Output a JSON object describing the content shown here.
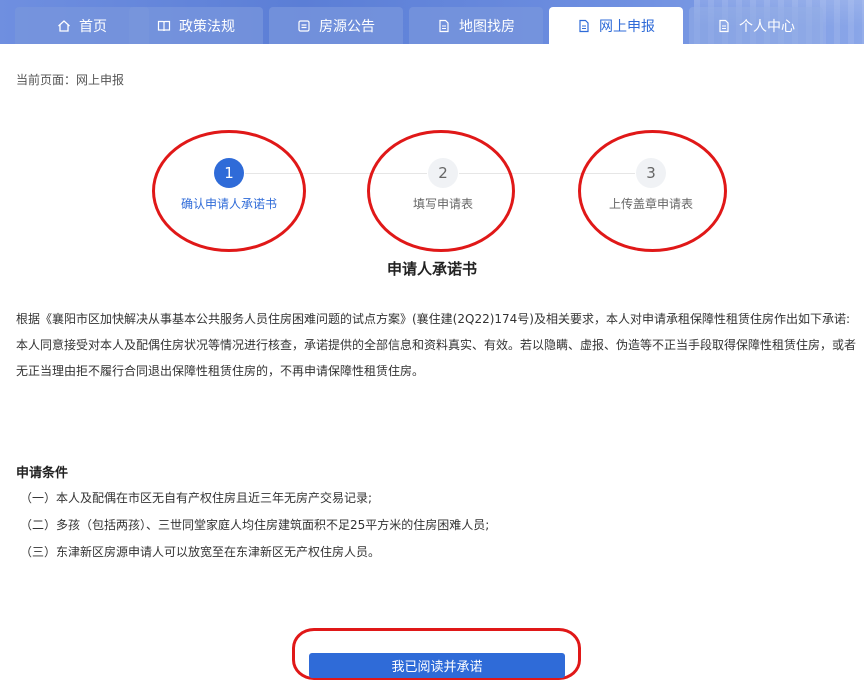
{
  "nav": {
    "tabs": [
      {
        "label": "首页",
        "icon": "home-icon",
        "active": false
      },
      {
        "label": "政策法规",
        "icon": "book-icon",
        "active": false
      },
      {
        "label": "房源公告",
        "icon": "notice-icon",
        "active": false
      },
      {
        "label": "地图找房",
        "icon": "document-icon",
        "active": false
      },
      {
        "label": "网上申报",
        "icon": "document-icon",
        "active": true
      },
      {
        "label": "个人中心",
        "icon": "document-icon",
        "active": false
      }
    ]
  },
  "breadcrumb": {
    "text": "当前页面：网上申报"
  },
  "steps": [
    {
      "number": "1",
      "label": "确认申请人承诺书",
      "status": "done"
    },
    {
      "number": "2",
      "label": "填写申请表",
      "status": "todo"
    },
    {
      "number": "3",
      "label": "上传盖章申请表",
      "status": "todo"
    }
  ],
  "commitment": {
    "title": "申请人承诺书",
    "paragraphs": [
      "根据《襄阳市区加快解决从事基本公共服务人员住房困难问题的试点方案》(襄住建(2Q22)174号)及相关要求，本人对申请承租保障性租赁住房作出如下承诺:",
      "本人同意接受对本人及配偶住房状况等情况进行核查，承诺提供的全部信息和资料真实、有效。若以隐瞒、虚报、伪造等不正当手段取得保障性租赁住房，或者无正当理由拒不履行合同退出保障性租赁住房的，不再申请保障性租赁住房。"
    ]
  },
  "conditions": {
    "title": "申请条件",
    "items": [
      "（一）本人及配偶在市区无自有产权住房且近三年无房产交易记录;",
      "（二）多孩（包括两孩）、三世同堂家庭人均住房建筑面积不足25平方米的住房困难人员;",
      "（三）东津新区房源申请人可以放宽至在东津新区无产权住房人员。"
    ]
  },
  "actions": {
    "agree_label": "我已阅读并承诺"
  },
  "colors": {
    "primary": "#2f6bd8",
    "annotation": "#e01818",
    "nav_bg": "#6f8fe0"
  }
}
